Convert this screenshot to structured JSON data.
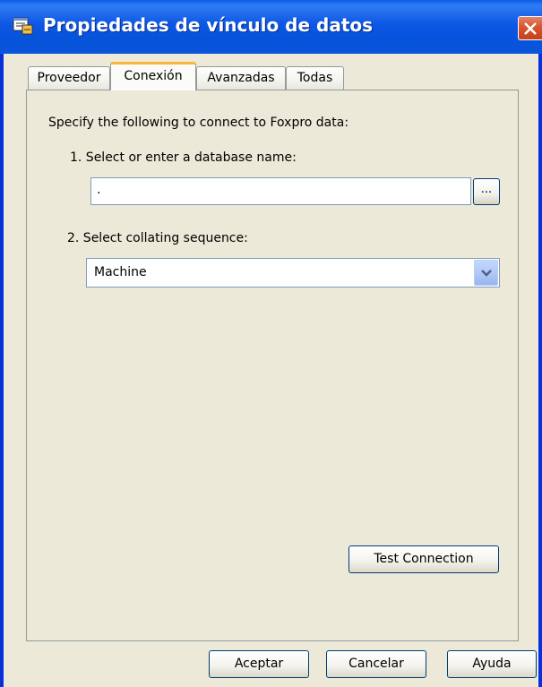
{
  "window": {
    "title": "Propiedades de vínculo de datos",
    "close_icon": "close-icon"
  },
  "tabs": [
    {
      "label": "Proveedor",
      "active": false
    },
    {
      "label": "Conexión",
      "active": true
    },
    {
      "label": "Avanzadas",
      "active": false
    },
    {
      "label": "Todas",
      "active": false
    }
  ],
  "connection": {
    "intro": "Specify the following to connect to Foxpro data:",
    "step1_label": "1. Select or enter a database name:",
    "database_value": ".",
    "browse_label": "...",
    "step2_label": "2. Select collating sequence:",
    "collating_value": "Machine",
    "test_button": "Test Connection"
  },
  "footer": {
    "ok": "Aceptar",
    "cancel": "Cancelar",
    "help": "Ayuda"
  },
  "colors": {
    "titlebar": "#0a55d9",
    "dialog_bg": "#ece9d8",
    "active_tab_highlight": "#f9b43a",
    "close_button": "#d8542e"
  }
}
